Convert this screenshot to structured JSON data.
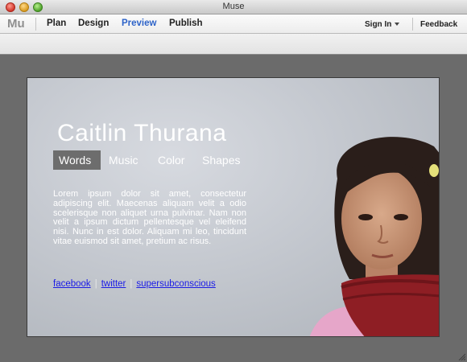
{
  "window": {
    "title": "Muse"
  },
  "menubar": {
    "logo": "Mu",
    "items": [
      {
        "label": "Plan",
        "active": false
      },
      {
        "label": "Design",
        "active": false
      },
      {
        "label": "Preview",
        "active": true
      },
      {
        "label": "Publish",
        "active": false
      }
    ],
    "sign_in": "Sign In",
    "feedback": "Feedback"
  },
  "site": {
    "title": "Caitlin Thurana",
    "nav": [
      {
        "label": "Words",
        "selected": true
      },
      {
        "label": "Music",
        "selected": false
      },
      {
        "label": "Color",
        "selected": false
      },
      {
        "label": "Shapes",
        "selected": false
      }
    ],
    "paragraph": "Lorem ipsum dolor sit amet, consectetur adipiscing elit. Maecenas aliquam velit a odio scelerisque non aliquet urna pulvinar. Nam non velit a ipsum dictum pellentesque vel eleifend nisi. Nunc in est dolor. Aliquam mi leo, tincidunt vitae euismod sit amet, pretium ac risus.",
    "links": [
      {
        "label": "facebook"
      },
      {
        "label": "twitter"
      },
      {
        "label": "supersubconscious"
      }
    ],
    "link_separator": "|"
  },
  "colors": {
    "active_menu": "#2d63c8",
    "link": "#1b1be6",
    "nav_selected_bg": "#6d6d6d",
    "workspace_bg": "#6b6b6b"
  },
  "icons": {
    "close": "close-icon",
    "minimize": "minimize-icon",
    "maximize": "maximize-icon",
    "dropdown": "chevron-down-icon",
    "resize": "resize-grip-icon"
  }
}
